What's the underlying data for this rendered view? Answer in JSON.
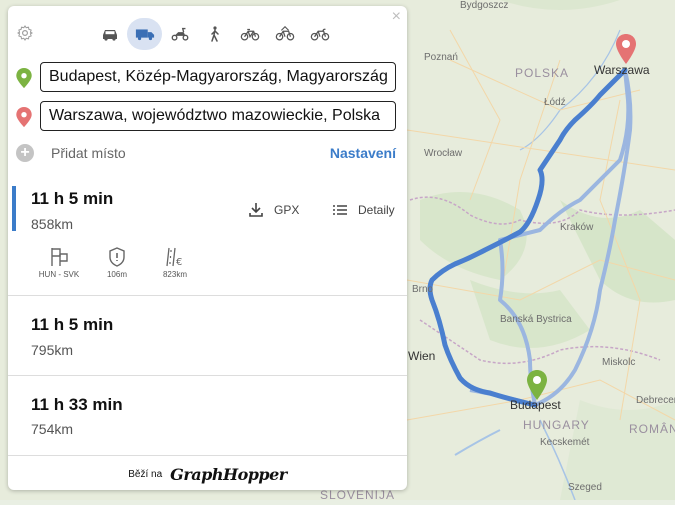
{
  "map": {
    "labels": {
      "bydgoszcz": "Bydgoszcz",
      "poznan": "Poznań",
      "polska": "POLSKA",
      "warszawa": "Warszawa",
      "lodz": "Łódź",
      "wroclaw": "Wrocław",
      "krakow": "Kraków",
      "brno": "Brno",
      "banska": "Banská Bystrica",
      "wien": "Wien",
      "miskolc": "Miskolc",
      "budapest": "Budapest",
      "hungary": "HUNGARY",
      "kecskemet": "Kecskemét",
      "debrecen": "Debrecen",
      "romania": "ROMÂNIA",
      "szeged": "Szeged",
      "slovenija": "SLOVENIJA"
    },
    "route_color": "#4a7fcf",
    "alt_route_color": "#9bb6e0"
  },
  "panel": {
    "close": "×",
    "modes": [
      {
        "icon": "car-icon",
        "active": false
      },
      {
        "icon": "truck-icon",
        "active": true
      },
      {
        "icon": "scooter-icon",
        "active": false
      },
      {
        "icon": "walking-icon",
        "active": false
      },
      {
        "icon": "bike-icon",
        "active": false
      },
      {
        "icon": "mountain-bike-icon",
        "active": false
      },
      {
        "icon": "racing-bike-icon",
        "active": false
      }
    ],
    "from": "Budapest, Közép-Magyarország, Magyarország",
    "to": "Warszawa, województwo mazowieckie, Polska",
    "add_label": "Přidat místo",
    "settings_label": "Nastavení",
    "routes": [
      {
        "time": "11 h 5 min",
        "distance": "858km"
      },
      {
        "time": "11 h 5 min",
        "distance": "795km"
      },
      {
        "time": "11 h 33 min",
        "distance": "754km"
      }
    ],
    "gpx_label": "GPX",
    "details_label": "Detaily",
    "detail_items": [
      {
        "icon": "border-crossing-icon",
        "label": "HUN - SVK"
      },
      {
        "icon": "toll-icon",
        "label": "106m"
      },
      {
        "icon": "motorway-icon",
        "label": "823km"
      }
    ],
    "footer_text": "Běží na",
    "brand": "GraphHopper"
  },
  "colors": {
    "start_pin": "#6aa83c",
    "end_pin": "#e57373",
    "accent": "#3b7cc9"
  }
}
